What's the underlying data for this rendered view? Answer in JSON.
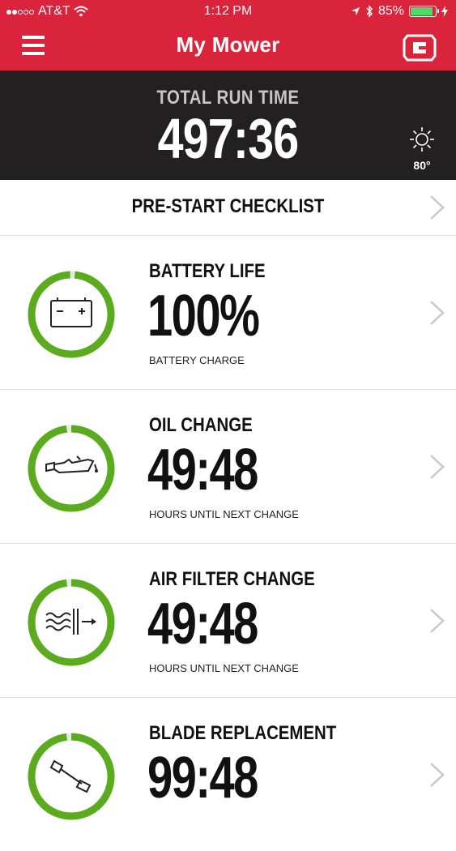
{
  "status_bar": {
    "carrier": "AT&T",
    "time": "1:12 PM",
    "battery_percent": "85%",
    "battery_level": 0.85
  },
  "nav": {
    "title": "My Mower",
    "menu_icon": "hamburger-icon",
    "logo_icon": "brand-logo-icon"
  },
  "runtime": {
    "label": "TOTAL RUN TIME",
    "value": "497:36",
    "weather_icon": "sun-icon",
    "temperature": "80°"
  },
  "checklist": {
    "label": "PRE-START CHECKLIST"
  },
  "items": [
    {
      "title": "BATTERY LIFE",
      "value": "100%",
      "sub": "BATTERY CHARGE",
      "icon": "battery-icon",
      "level": 1.0
    },
    {
      "title": "OIL CHANGE",
      "value": "49:48",
      "sub": "HOURS UNTIL NEXT CHANGE",
      "icon": "oil-can-icon",
      "level": 1.0
    },
    {
      "title": "AIR FILTER CHANGE",
      "value": "49:48",
      "sub": "HOURS UNTIL NEXT CHANGE",
      "icon": "air-filter-icon",
      "level": 1.0
    },
    {
      "title": "BLADE REPLACEMENT",
      "value": "99:48",
      "sub": "",
      "icon": "blade-icon",
      "level": 1.0
    }
  ],
  "colors": {
    "brand_red": "#d9243c",
    "header_dark": "#232021",
    "ring_green": "#5aab1e"
  }
}
